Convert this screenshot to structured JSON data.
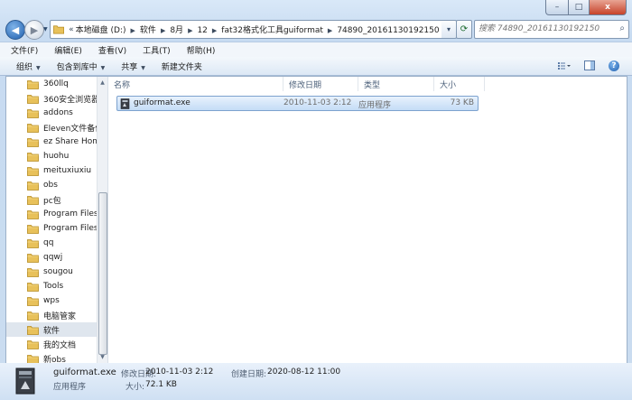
{
  "window": {
    "caption_buttons": {
      "minimize": "–",
      "maximize": "□",
      "close": "x"
    }
  },
  "nav": {
    "back_glyph": "◀",
    "forward_glyph": "▶",
    "dropdown_glyph": "▼",
    "breadcrumb_more": "«",
    "breadcrumbs": [
      "本地磁盘 (D:)",
      "软件",
      "8月",
      "12",
      "fat32格式化工具guiformat",
      "74890_20161130192150"
    ],
    "search_placeholder": "搜索 74890_20161130192150"
  },
  "menu": [
    "文件(F)",
    "编辑(E)",
    "查看(V)",
    "工具(T)",
    "帮助(H)"
  ],
  "toolbar": {
    "items": [
      {
        "label": "组织",
        "has_dropdown": true
      },
      {
        "label": "包含到库中",
        "has_dropdown": true
      },
      {
        "label": "共享",
        "has_dropdown": true
      },
      {
        "label": "新建文件夹",
        "has_dropdown": false
      }
    ],
    "right_icons": [
      "view-options-icon",
      "preview-pane-icon",
      "help-icon"
    ]
  },
  "tree": {
    "items": [
      {
        "label": "360llq",
        "selected": false
      },
      {
        "label": "360安全浏览器",
        "selected": false
      },
      {
        "label": "addons",
        "selected": false
      },
      {
        "label": "Eleven文件备份",
        "selected": false
      },
      {
        "label": "ez Share Hom",
        "selected": false
      },
      {
        "label": "huohu",
        "selected": false
      },
      {
        "label": "meituxiuxiu",
        "selected": false
      },
      {
        "label": "obs",
        "selected": false
      },
      {
        "label": "pc包",
        "selected": false
      },
      {
        "label": "Program Files",
        "selected": false
      },
      {
        "label": "Program Files",
        "selected": false
      },
      {
        "label": "qq",
        "selected": false
      },
      {
        "label": "qqwj",
        "selected": false
      },
      {
        "label": "sougou",
        "selected": false
      },
      {
        "label": "Tools",
        "selected": false
      },
      {
        "label": "wps",
        "selected": false
      },
      {
        "label": "电脑管家",
        "selected": false
      },
      {
        "label": "软件",
        "selected": true
      },
      {
        "label": "我的文档",
        "selected": false
      },
      {
        "label": "新obs",
        "selected": false
      }
    ]
  },
  "columns": [
    "名称",
    "修改日期",
    "类型",
    "大小"
  ],
  "files": [
    {
      "name": "guiformat.exe",
      "modified": "2010-11-03 2:12",
      "type": "应用程序",
      "size": "73 KB",
      "selected": true
    }
  ],
  "details": {
    "name": "guiformat.exe",
    "type": "应用程序",
    "modified_label": "修改日期:",
    "modified_value": "2010-11-03 2:12",
    "created_label": "创建日期:",
    "created_value": "2020-08-12 11:00",
    "size_label": "大小:",
    "size_value": "72.1 KB"
  },
  "colors": {
    "selection_border": "#7da2ce",
    "folder_yellow": "#e8c15a",
    "window_chrome": "#c7dbf1"
  }
}
